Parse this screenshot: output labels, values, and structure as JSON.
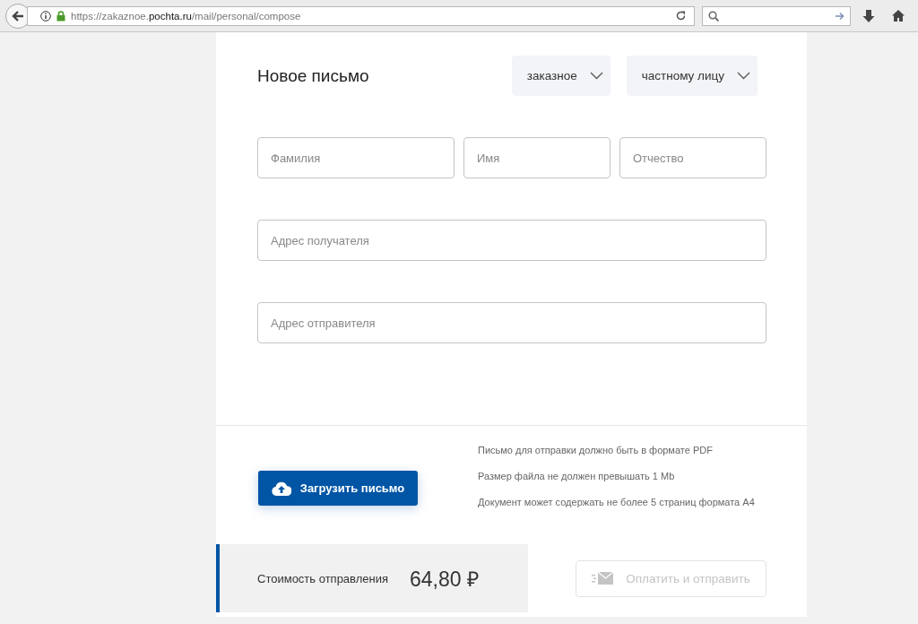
{
  "browser": {
    "url": "https://zakaznoe.**pochta.ru**/mail/personal/compose"
  },
  "form": {
    "title": "Новое письмо",
    "selects": [
      {
        "value": "заказное"
      },
      {
        "value": "частному лицу"
      }
    ],
    "name_fields": [
      {
        "placeholder": "Фамилия"
      },
      {
        "placeholder": "Имя"
      },
      {
        "placeholder": "Отчество"
      }
    ],
    "address_fields": [
      {
        "placeholder": "Адрес получателя"
      },
      {
        "placeholder": "Адрес отправителя"
      }
    ]
  },
  "upload": {
    "button": "Загрузить письмо",
    "notes": [
      "Письмо для отправки должно быть в формате PDF",
      "Размер файла не должен превышать 1 Mb",
      "Документ может содержать не более 5 страниц формата А4"
    ]
  },
  "footer": {
    "cost_label": "Стоимость отправления",
    "cost_value": "64,80 ₽",
    "pay_button": {
      "label": "Оплатить и отправить",
      "disabled": true
    }
  }
}
